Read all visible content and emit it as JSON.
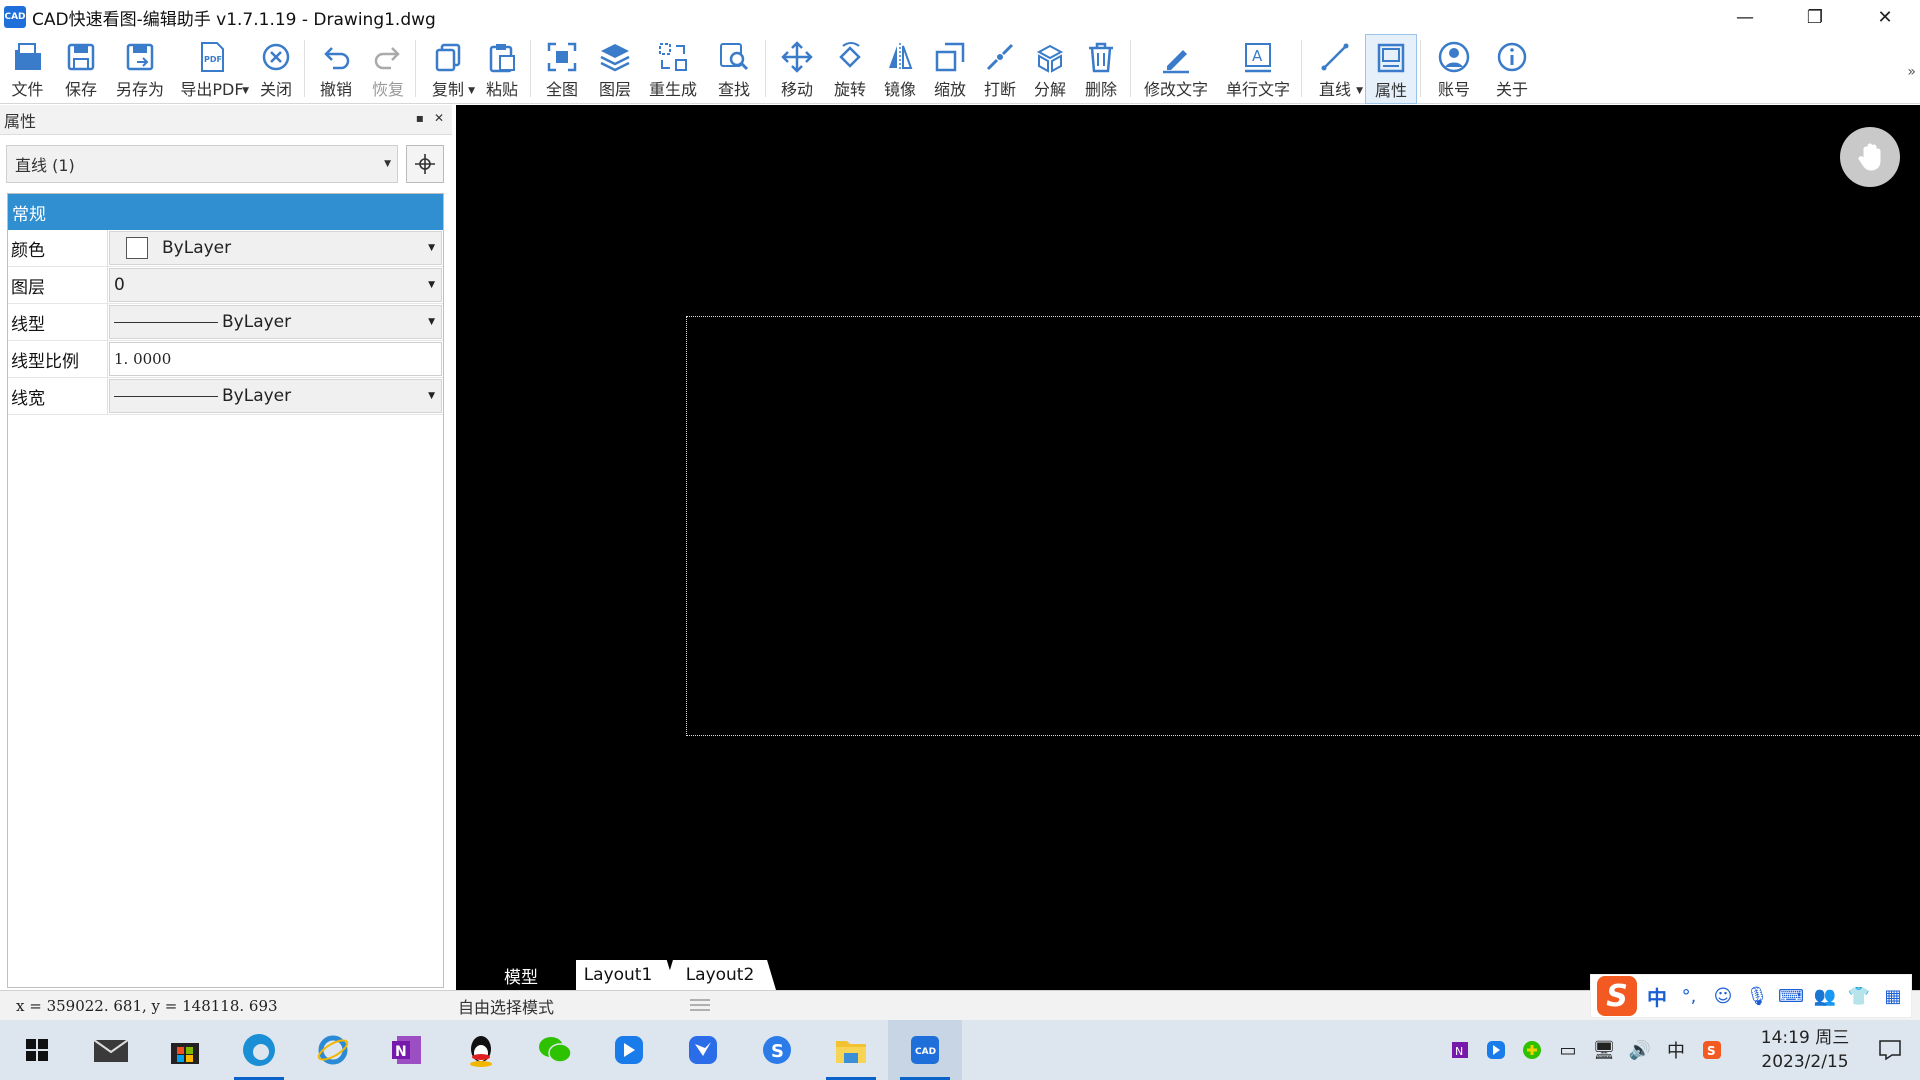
{
  "window": {
    "title": "CAD快速看图-编辑助手 v1.7.1.19 - Drawing1.dwg",
    "app_icon_text": "CAD",
    "minimize": "—",
    "restore": "❐",
    "close": "✕"
  },
  "toolbar": {
    "items": [
      {
        "label": "文件",
        "icon": "open-file-icon"
      },
      {
        "label": "保存",
        "icon": "save-icon"
      },
      {
        "label": "另存为",
        "icon": "save-as-icon"
      },
      {
        "label": "导出PDF",
        "icon": "export-pdf-icon",
        "dropdown": true
      },
      {
        "label": "关闭",
        "icon": "close-circle-icon"
      },
      {
        "label": "撤销",
        "icon": "undo-icon"
      },
      {
        "label": "恢复",
        "icon": "redo-icon",
        "disabled": true
      },
      {
        "label": "复制",
        "icon": "copy-icon",
        "dropdown": true
      },
      {
        "label": "粘贴",
        "icon": "paste-icon"
      },
      {
        "label": "全图",
        "icon": "zoom-extents-icon"
      },
      {
        "label": "图层",
        "icon": "layers-icon"
      },
      {
        "label": "重生成",
        "icon": "regen-icon"
      },
      {
        "label": "查找",
        "icon": "find-icon"
      },
      {
        "label": "移动",
        "icon": "move-icon"
      },
      {
        "label": "旋转",
        "icon": "rotate-icon"
      },
      {
        "label": "镜像",
        "icon": "mirror-icon"
      },
      {
        "label": "缩放",
        "icon": "scale-icon"
      },
      {
        "label": "打断",
        "icon": "break-icon"
      },
      {
        "label": "分解",
        "icon": "explode-icon"
      },
      {
        "label": "删除",
        "icon": "delete-icon"
      },
      {
        "label": "修改文字",
        "icon": "edit-text-icon"
      },
      {
        "label": "单行文字",
        "icon": "single-line-text-icon"
      },
      {
        "label": "直线",
        "icon": "line-icon",
        "dropdown": true
      },
      {
        "label": "属性",
        "icon": "properties-icon",
        "active": true
      },
      {
        "label": "账号",
        "icon": "account-icon"
      },
      {
        "label": "关于",
        "icon": "about-icon"
      }
    ],
    "more": "»"
  },
  "panel": {
    "title": "属性",
    "float_btn": "▪",
    "close_btn": "✕",
    "object_select": "直线 (1)",
    "category": "常规",
    "props": {
      "color_name": "颜色",
      "color_value": "ByLayer",
      "layer_name": "图层",
      "layer_value": "0",
      "linetype_name": "线型",
      "linetype_value": "ByLayer",
      "ltscale_name": "线型比例",
      "ltscale_value": "1. 0000",
      "lineweight_name": "线宽",
      "lineweight_value": "ByLayer"
    }
  },
  "tabs": {
    "model": "模型",
    "layout1": "Layout1",
    "layout2": "Layout2"
  },
  "status": {
    "coords": "x = 359022. 681,  y = 148118. 693",
    "mode": "自由选择模式"
  },
  "ime": {
    "lang": "中",
    "punct": "°,"
  },
  "tray": {
    "lang": "中",
    "time": "14:19 周三",
    "date": "2023/2/15"
  },
  "colors": {
    "category_bar": "#2f8fd0",
    "canvas_bg": "#000000",
    "taskbar_bg": "#dde6ef",
    "accent": "#0a63c9"
  }
}
